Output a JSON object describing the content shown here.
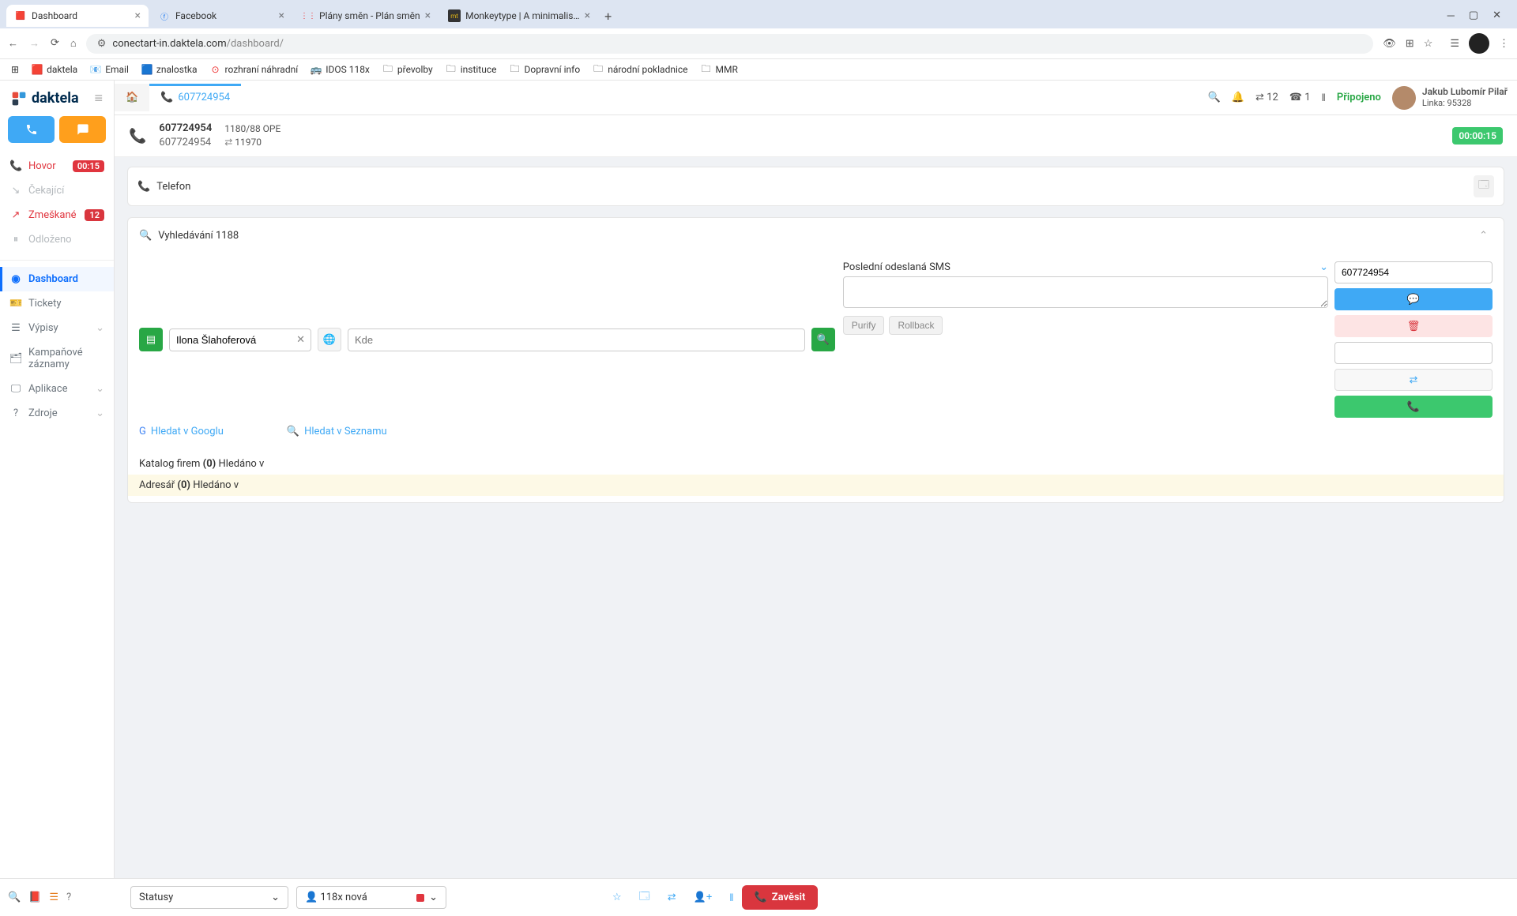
{
  "browser": {
    "tabs": [
      {
        "title": "Dashboard",
        "favicon": "daktela"
      },
      {
        "title": "Facebook",
        "favicon": "fb"
      },
      {
        "title": "Plány směn - Plán směn",
        "favicon": "grid"
      },
      {
        "title": "Monkeytype | A minimalistic, c...",
        "favicon": "mt"
      }
    ],
    "url_host": "conectart-in.daktela.com",
    "url_path": "/dashboard/"
  },
  "bookmarks": [
    "daktela",
    "Email",
    "znalostka",
    "rozhraní náhradní",
    "IDOS 118x",
    "převolby",
    "instituce",
    "Dopravní info",
    "národní pokladnice",
    "MMR"
  ],
  "logo": "daktela",
  "sidebar": {
    "hovor": {
      "label": "Hovor",
      "badge": "00:15"
    },
    "cekajici": "Čekající",
    "zmeskane": {
      "label": "Zmeškané",
      "badge": "12"
    },
    "odlozeno": "Odloženo",
    "dashboard": "Dashboard",
    "tickety": "Tickety",
    "vypisy": "Výpisy",
    "kampan": "Kampaňové záznamy",
    "aplikace": "Aplikace",
    "zdroje": "Zdroje"
  },
  "apptabs": {
    "call": "607724954"
  },
  "topbar": {
    "transfer_count": "12",
    "line_count": "1",
    "status": "Připojeno",
    "user_name": "Jakub Lubomír Pilař",
    "user_line": "Linka: 95328"
  },
  "call": {
    "num1": "607724954",
    "num2": "607724954",
    "ope": "1180/88 OPE",
    "route": "11970",
    "timer": "00:00:15"
  },
  "panels": {
    "telefon": "Telefon",
    "search_title": "Vyhledávání 1188"
  },
  "search": {
    "who_value": "Ilona Šlahoferová",
    "where_placeholder": "Kde",
    "google_link": "Hledat v Googlu",
    "seznam_link": "Hledat v Seznamu"
  },
  "sms": {
    "title": "Poslední odeslaná SMS",
    "number": "607724954",
    "purify": "Purify",
    "rollback": "Rollback"
  },
  "katalog": {
    "line1_a": "Katalog firem ",
    "line1_b": "(0)",
    "line1_c": " Hledáno v",
    "line2_a": "Adresář ",
    "line2_b": "(0)",
    "line2_c": " Hledáno v"
  },
  "bottom": {
    "statusy": "Statusy",
    "queue": "118x nová",
    "zavesit": "Zavěsit"
  }
}
